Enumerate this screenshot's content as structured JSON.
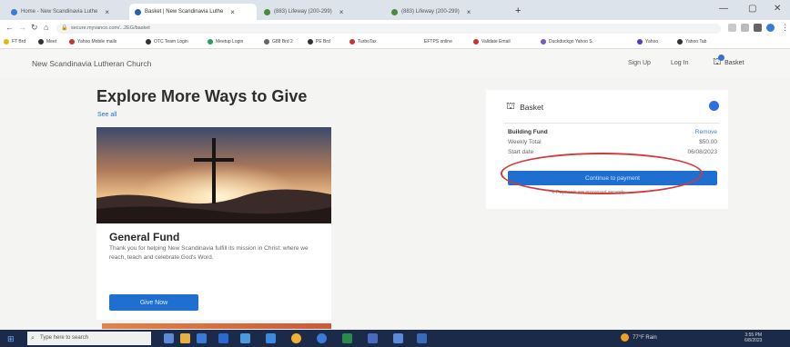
{
  "browser": {
    "tabs": [
      {
        "label": "Home - New Scandinavia Luthe"
      },
      {
        "label": "Basket | New Scandinavia Luthe"
      },
      {
        "label": "(883) Lifeway (200-299)"
      },
      {
        "label": "(883) Lifeway (200-299)"
      }
    ],
    "url": "secure.myvanco.com/...2EG/basket",
    "bookmarks": [
      "FT Brd",
      "Meet",
      "Yahoo Mobile mails",
      "OTC Team Login",
      "Meetup Login",
      "G88 Brd 2",
      "PE Brd",
      "TurboTax",
      "EFTPS online",
      "Validate Email",
      "Duckduckgo Yahoo S.",
      "Yahoo",
      "Yahoo Tab"
    ]
  },
  "header": {
    "church_name": "New Scandinavia Lutheran Church",
    "sign_up": "Sign Up",
    "log_in": "Log In",
    "basket": "Basket"
  },
  "main": {
    "title": "Explore More Ways to Give",
    "see_all": "See all",
    "fund_card": {
      "title": "General Fund",
      "description": "Thank you for helping New Scandinavia fulfill its mission in Christ: where we reach, teach and celebrate God's Word.",
      "button": "Give Now"
    }
  },
  "basket_panel": {
    "title": "Basket",
    "fund_name": "Building Fund",
    "remove_label": "Remove",
    "rows": [
      {
        "label": "Weekly Total",
        "value": "$50.00"
      },
      {
        "label": "Start date",
        "value": "06/08/2023"
      }
    ],
    "continue_button": "Continue to payment",
    "secure_note": "Payments are processed securely"
  },
  "taskbar": {
    "search_placeholder": "Type here to search",
    "weather": "77°F Rain",
    "time": "3:55 PM",
    "date": "6/8/2023"
  },
  "colors": {
    "accent": "#1f6fd0",
    "highlight": "#d23a3a",
    "taskbar": "#1b2a48"
  }
}
